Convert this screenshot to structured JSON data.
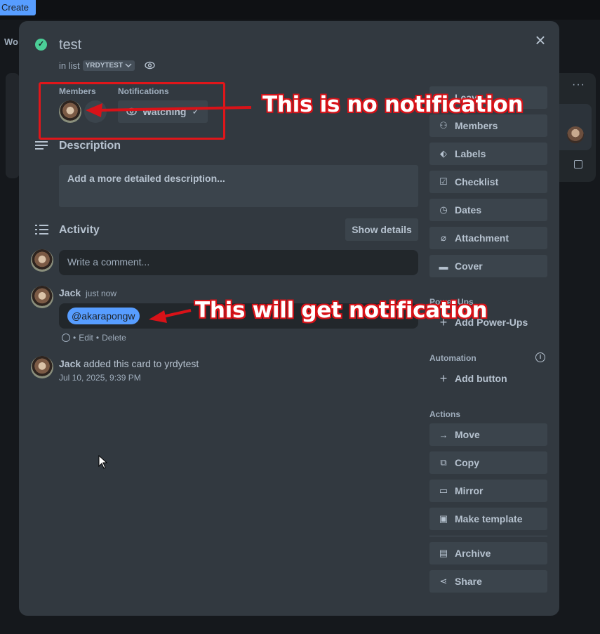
{
  "background": {
    "create_label": "Create",
    "workspace_fragment": "Wo"
  },
  "card": {
    "title": "test",
    "in_list_prefix": "in list",
    "list_name": "YRDYTEST"
  },
  "members": {
    "label": "Members"
  },
  "notifications": {
    "label": "Notifications",
    "watch_label": "Watching"
  },
  "description": {
    "title": "Description",
    "placeholder": "Add a more detailed description..."
  },
  "activity": {
    "title": "Activity",
    "show_details": "Show details",
    "comment_placeholder": "Write a comment...",
    "comment": {
      "author": "Jack",
      "time": "just now",
      "mention": "@akarapongw",
      "edit": "Edit",
      "delete": "Delete",
      "separator": "•"
    },
    "entry": {
      "author": "Jack",
      "text": "added this card to yrdytest",
      "timestamp": "Jul 10, 2025, 9:39 PM"
    }
  },
  "sidebar": {
    "top_buttons": [
      {
        "label": "Leave",
        "icon": "leave-icon"
      },
      {
        "label": "Members",
        "icon": "person-icon"
      },
      {
        "label": "Labels",
        "icon": "tag-icon"
      },
      {
        "label": "Checklist",
        "icon": "checkbox-icon"
      },
      {
        "label": "Dates",
        "icon": "clock-icon"
      },
      {
        "label": "Attachment",
        "icon": "paperclip-icon"
      },
      {
        "label": "Cover",
        "icon": "cover-icon"
      }
    ],
    "powerups_label": "Power-Ups",
    "add_powerups": "Add Power-Ups",
    "automation_label": "Automation",
    "add_button": "Add button",
    "actions_label": "Actions",
    "actions": [
      {
        "label": "Move",
        "icon": "arrow-right-icon"
      },
      {
        "label": "Copy",
        "icon": "copy-icon"
      },
      {
        "label": "Mirror",
        "icon": "mirror-icon"
      },
      {
        "label": "Make template",
        "icon": "template-icon"
      }
    ],
    "archive": "Archive",
    "share": "Share"
  },
  "annotations": {
    "top": "This is no notification",
    "bottom": "This will get notification",
    "color": "#d81218"
  },
  "colors": {
    "modal_bg": "#323940",
    "button_bg": "#3b444c",
    "mention_bg": "#579dff",
    "success": "#4bce97"
  }
}
